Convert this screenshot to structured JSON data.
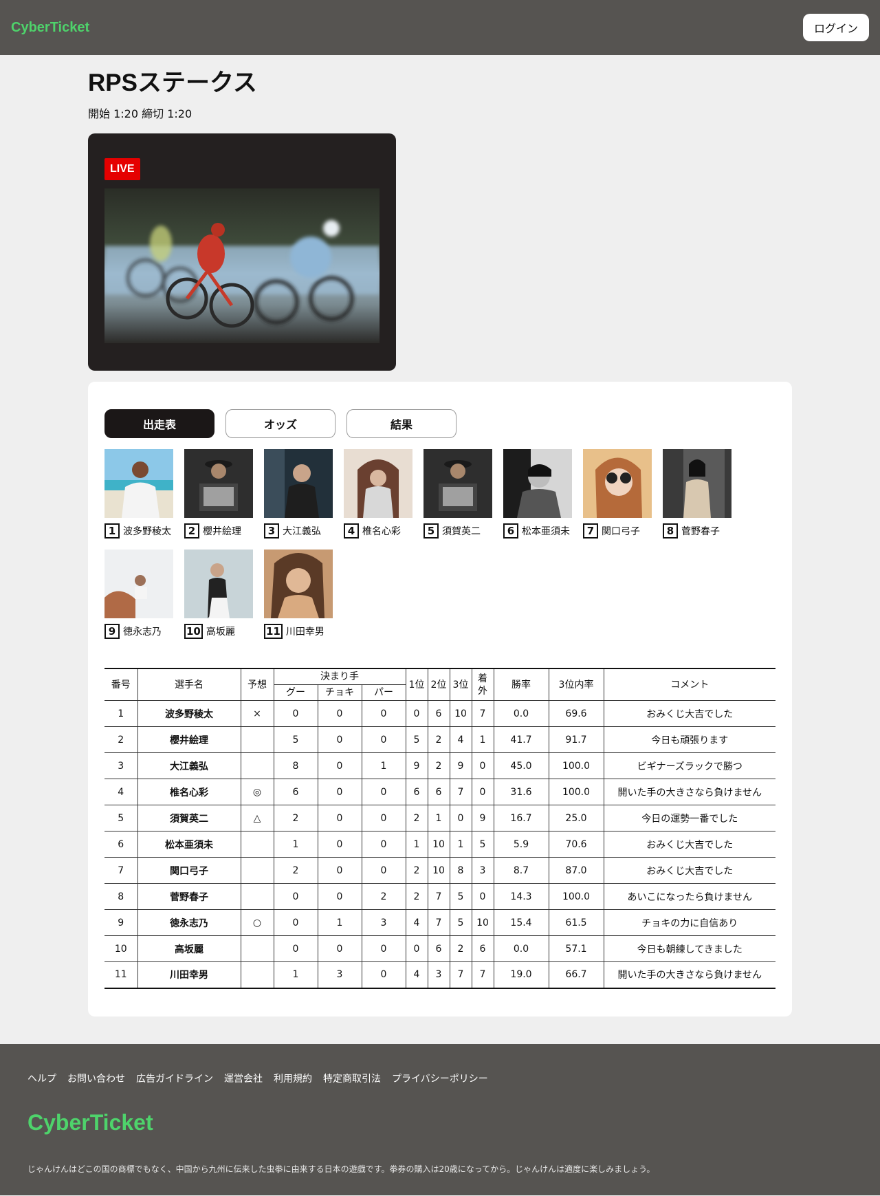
{
  "header": {
    "logo": "CyberTicket",
    "login_label": "ログイン"
  },
  "race": {
    "title": "RPSステークス",
    "times": "開始 1:20 締切 1:20",
    "live_label": "LIVE"
  },
  "tabs": [
    "出走表",
    "オッズ",
    "結果"
  ],
  "players": [
    {
      "no": "1",
      "name": "波多野稜太"
    },
    {
      "no": "2",
      "name": "櫻井絵理"
    },
    {
      "no": "3",
      "name": "大江義弘"
    },
    {
      "no": "4",
      "name": "椎名心彩"
    },
    {
      "no": "5",
      "name": "須賀英二"
    },
    {
      "no": "6",
      "name": "松本亜須未"
    },
    {
      "no": "7",
      "name": "関口弓子"
    },
    {
      "no": "8",
      "name": "菅野春子"
    },
    {
      "no": "9",
      "name": "徳永志乃"
    },
    {
      "no": "10",
      "name": "高坂麗"
    },
    {
      "no": "11",
      "name": "川田幸男"
    }
  ],
  "table": {
    "headers": {
      "no": "番号",
      "name": "選手名",
      "prediction": "予想",
      "kimarite": "決まり手",
      "goo": "グー",
      "choki": "チョキ",
      "pa": "パー",
      "p1": "1位",
      "p2": "2位",
      "p3": "3位",
      "out": "着外",
      "win_rate": "勝率",
      "top3_rate": "3位内率",
      "comment": "コメント"
    },
    "rows": [
      {
        "no": "1",
        "name": "波多野稜太",
        "pred": "×",
        "goo": "0",
        "choki": "0",
        "pa": "0",
        "p1": "0",
        "p2": "6",
        "p3": "10",
        "out": "7",
        "win": "0.0",
        "top3": "69.6",
        "comment": "おみくじ大吉でした"
      },
      {
        "no": "2",
        "name": "櫻井絵理",
        "pred": "",
        "goo": "5",
        "choki": "0",
        "pa": "0",
        "p1": "5",
        "p2": "2",
        "p3": "4",
        "out": "1",
        "win": "41.7",
        "top3": "91.7",
        "comment": "今日も頑張ります"
      },
      {
        "no": "3",
        "name": "大江義弘",
        "pred": "",
        "goo": "8",
        "choki": "0",
        "pa": "1",
        "p1": "9",
        "p2": "2",
        "p3": "9",
        "out": "0",
        "win": "45.0",
        "top3": "100.0",
        "comment": "ビギナーズラックで勝つ"
      },
      {
        "no": "4",
        "name": "椎名心彩",
        "pred": "◎",
        "goo": "6",
        "choki": "0",
        "pa": "0",
        "p1": "6",
        "p2": "6",
        "p3": "7",
        "out": "0",
        "win": "31.6",
        "top3": "100.0",
        "comment": "開いた手の大きさなら負けません"
      },
      {
        "no": "5",
        "name": "須賀英二",
        "pred": "△",
        "goo": "2",
        "choki": "0",
        "pa": "0",
        "p1": "2",
        "p2": "1",
        "p3": "0",
        "out": "9",
        "win": "16.7",
        "top3": "25.0",
        "comment": "今日の運勢一番でした"
      },
      {
        "no": "6",
        "name": "松本亜須未",
        "pred": "",
        "goo": "1",
        "choki": "0",
        "pa": "0",
        "p1": "1",
        "p2": "10",
        "p3": "1",
        "out": "5",
        "win": "5.9",
        "top3": "70.6",
        "comment": "おみくじ大吉でした"
      },
      {
        "no": "7",
        "name": "関口弓子",
        "pred": "",
        "goo": "2",
        "choki": "0",
        "pa": "0",
        "p1": "2",
        "p2": "10",
        "p3": "8",
        "out": "3",
        "win": "8.7",
        "top3": "87.0",
        "comment": "おみくじ大吉でした"
      },
      {
        "no": "8",
        "name": "菅野春子",
        "pred": "",
        "goo": "0",
        "choki": "0",
        "pa": "2",
        "p1": "2",
        "p2": "7",
        "p3": "5",
        "out": "0",
        "win": "14.3",
        "top3": "100.0",
        "comment": "あいこになったら負けません"
      },
      {
        "no": "9",
        "name": "徳永志乃",
        "pred": "○",
        "goo": "0",
        "choki": "1",
        "pa": "3",
        "p1": "4",
        "p2": "7",
        "p3": "5",
        "out": "10",
        "win": "15.4",
        "top3": "61.5",
        "comment": "チョキの力に自信あり"
      },
      {
        "no": "10",
        "name": "高坂麗",
        "pred": "",
        "goo": "0",
        "choki": "0",
        "pa": "0",
        "p1": "0",
        "p2": "6",
        "p3": "2",
        "out": "6",
        "win": "0.0",
        "top3": "57.1",
        "comment": "今日も朝練してきました"
      },
      {
        "no": "11",
        "name": "川田幸男",
        "pred": "",
        "goo": "1",
        "choki": "3",
        "pa": "0",
        "p1": "4",
        "p2": "3",
        "p3": "7",
        "out": "7",
        "win": "19.0",
        "top3": "66.7",
        "comment": "開いた手の大きさなら負けません"
      }
    ]
  },
  "footer": {
    "links": [
      "ヘルプ",
      "お問い合わせ",
      "広告ガイドライン",
      "運営会社",
      "利用規約",
      "特定商取引法",
      "プライバシーポリシー"
    ],
    "logo": "CyberTicket",
    "note": "じゃんけんはどこの国の商標でもなく、中国から九州に伝来した虫拳に由来する日本の遊戯です。拳券の購入は20歳になってから。じゃんけんは適度に楽しみましょう。"
  }
}
